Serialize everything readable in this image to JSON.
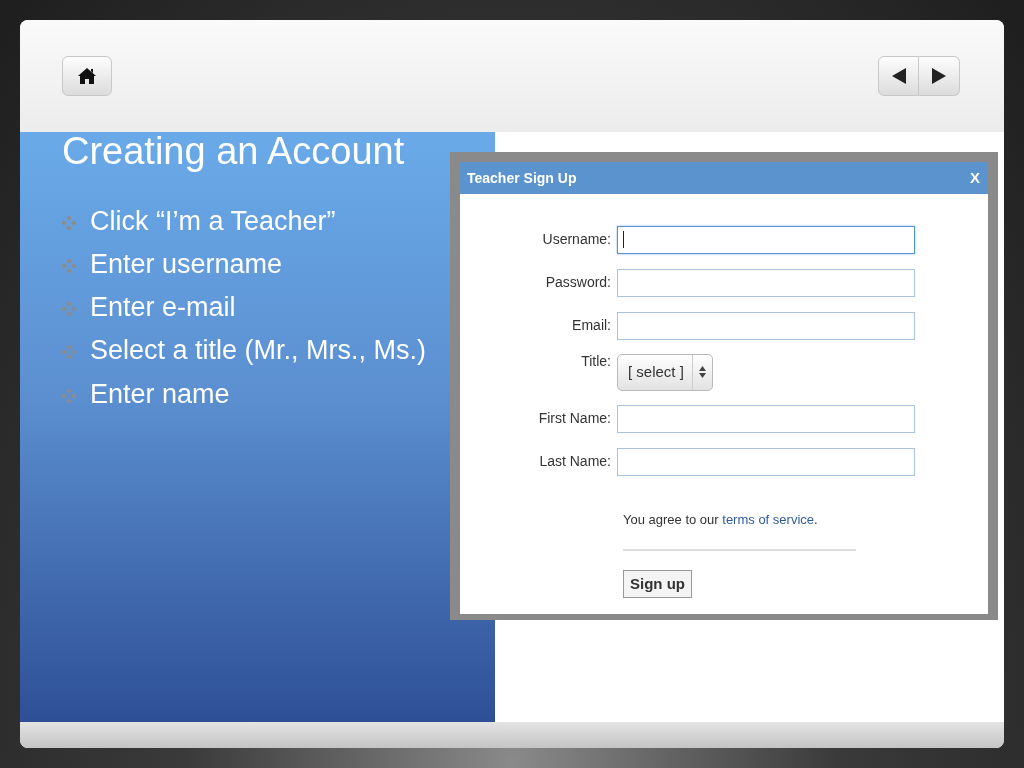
{
  "slide": {
    "title": "Creating an Account",
    "bullets": [
      "Click “I’m a Teacher”",
      "Enter username",
      "Enter e-mail",
      "Select a title (Mr., Mrs., Ms.)",
      "Enter name"
    ]
  },
  "dialog": {
    "title": "Teacher Sign Up",
    "close": "X",
    "fields": [
      {
        "label": "Username:",
        "kind": "text",
        "focused": true
      },
      {
        "label": "Password:",
        "kind": "text",
        "focused": false
      },
      {
        "label": "Email:",
        "kind": "text",
        "focused": false
      },
      {
        "label": "Title:",
        "kind": "select",
        "value": "[ select ]"
      },
      {
        "label": "First Name:",
        "kind": "text",
        "focused": false
      },
      {
        "label": "Last Name:",
        "kind": "text",
        "focused": false
      }
    ],
    "agreement": "You agree to our",
    "terms_link": "terms of service",
    "agreement_end": ".",
    "submit": "Sign up"
  }
}
